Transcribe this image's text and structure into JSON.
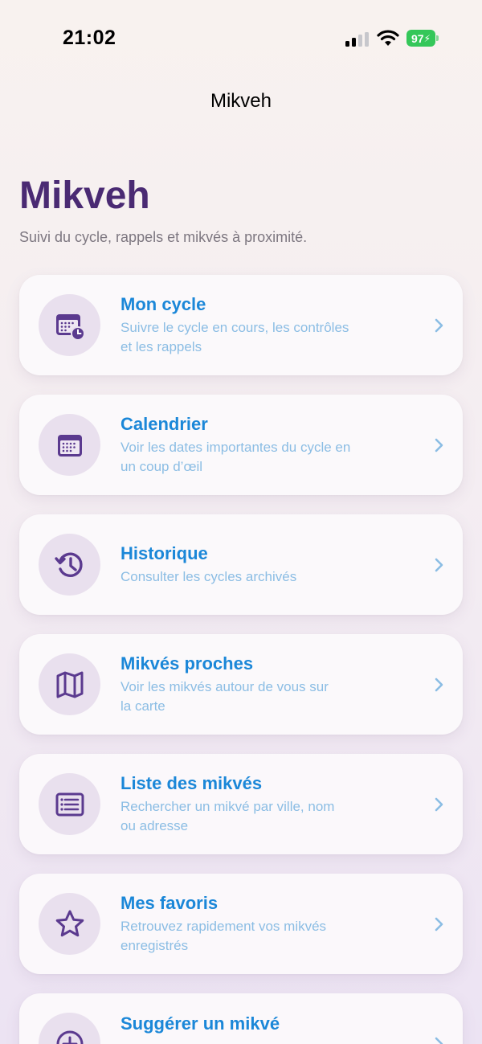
{
  "status_bar": {
    "time": "21:02",
    "battery": "97",
    "signal_icon": "cellular-signal-icon",
    "wifi_icon": "wifi-icon",
    "battery_color": "#34c759"
  },
  "nav": {
    "title": "Mikveh"
  },
  "header": {
    "title": "Mikveh",
    "subtitle": "Suivi du cycle, rappels et mikvés à proximité."
  },
  "colors": {
    "title_purple": "#4a2a73",
    "accent_blue": "#1b87d8",
    "desc_blue": "#8bbde4",
    "icon_purple": "#5b3a8f",
    "icon_bg": "#e9e0ee"
  },
  "menu": {
    "items": [
      {
        "icon": "calendar-clock-icon",
        "title": "Mon cycle",
        "desc1": "Suivre le cycle en cours, les contrôles",
        "desc2": "et les rappels"
      },
      {
        "icon": "calendar-icon",
        "title": "Calendrier",
        "desc1": "Voir les dates importantes du cycle en",
        "desc2": "un coup d’œil"
      },
      {
        "icon": "history-icon",
        "title": "Historique",
        "desc1": "Consulter les cycles archivés",
        "desc2": ""
      },
      {
        "icon": "map-icon",
        "title": "Mikvés proches",
        "desc1": "Voir les mikvés autour de vous sur",
        "desc2": "la carte"
      },
      {
        "icon": "list-icon",
        "title": "Liste des mikvés",
        "desc1": "Rechercher un mikvé par ville, nom",
        "desc2": "ou adresse"
      },
      {
        "icon": "star-icon",
        "title": "Mes favoris",
        "desc1": "Retrouvez rapidement vos mikvés",
        "desc2": "enregistrés"
      },
      {
        "icon": "plus-circle-icon",
        "title": "Suggérer un mikvé",
        "desc1": "",
        "desc2": ""
      }
    ]
  }
}
